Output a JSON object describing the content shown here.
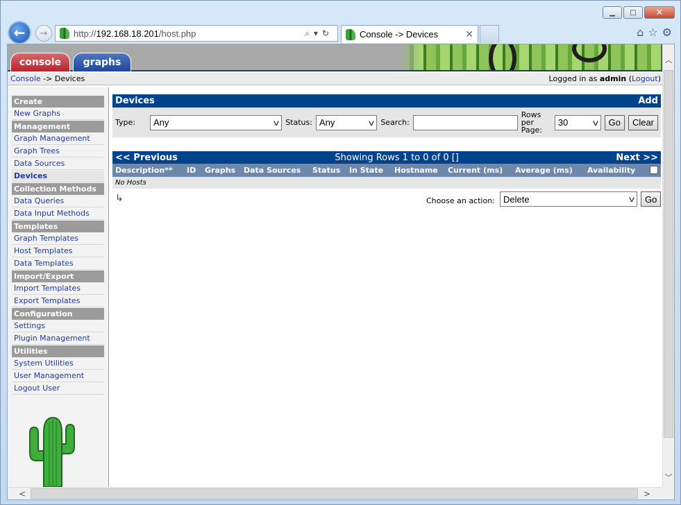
{
  "browser": {
    "url_prefix": "http://",
    "url_host": "192.168.18.201",
    "url_path": "/host.php",
    "tab_title": "Console -> Devices",
    "window_buttons": {
      "minimize": "▁",
      "maximize": "□",
      "close": "✕"
    },
    "icons": {
      "back": "←",
      "forward": "→",
      "search": "⌕",
      "dropdown": "▾",
      "refresh": "↻",
      "tab_close": "✕",
      "home": "⌂",
      "favorites": "☆",
      "settings": "⚙"
    }
  },
  "cacti": {
    "tabs": {
      "console": "console",
      "graphs": "graphs"
    },
    "breadcrumb": {
      "root": "Console",
      "sep": " -> ",
      "current": "Devices"
    },
    "login": {
      "prefix": "Logged in as ",
      "user": "admin",
      "open": " (",
      "logout": "Logout",
      "close": ")"
    },
    "menu": [
      {
        "type": "head",
        "label": "Create"
      },
      {
        "type": "item",
        "label": "New Graphs"
      },
      {
        "type": "head",
        "label": "Management"
      },
      {
        "type": "item",
        "label": "Graph Management"
      },
      {
        "type": "item",
        "label": "Graph Trees"
      },
      {
        "type": "item",
        "label": "Data Sources"
      },
      {
        "type": "item",
        "label": "Devices",
        "active": true
      },
      {
        "type": "head",
        "label": "Collection Methods"
      },
      {
        "type": "item",
        "label": "Data Queries"
      },
      {
        "type": "item",
        "label": "Data Input Methods"
      },
      {
        "type": "head",
        "label": "Templates"
      },
      {
        "type": "item",
        "label": "Graph Templates"
      },
      {
        "type": "item",
        "label": "Host Templates"
      },
      {
        "type": "item",
        "label": "Data Templates"
      },
      {
        "type": "head",
        "label": "Import/Export"
      },
      {
        "type": "item",
        "label": "Import Templates"
      },
      {
        "type": "item",
        "label": "Export Templates"
      },
      {
        "type": "head",
        "label": "Configuration"
      },
      {
        "type": "item",
        "label": "Settings"
      },
      {
        "type": "item",
        "label": "Plugin Management"
      },
      {
        "type": "head",
        "label": "Utilities"
      },
      {
        "type": "item",
        "label": "System Utilities"
      },
      {
        "type": "item",
        "label": "User Management"
      },
      {
        "type": "item",
        "label": "Logout User"
      }
    ],
    "devices": {
      "title": "Devices",
      "add": "Add",
      "filter": {
        "type_label": "Type:",
        "type_value": "Any",
        "status_label": "Status:",
        "status_value": "Any",
        "search_label": "Search:",
        "search_value": "",
        "rows_label": "Rows per Page:",
        "rows_value": "30",
        "go": "Go",
        "clear": "Clear"
      },
      "nav": {
        "prev": "<< Previous",
        "info": "Showing Rows 1 to 0 of 0 []",
        "next": "Next >>"
      },
      "columns": [
        "Description**",
        "ID",
        "Graphs",
        "Data Sources",
        "Status",
        "In State",
        "Hostname",
        "Current (ms)",
        "Average (ms)",
        "Availability"
      ],
      "empty": "No Hosts",
      "action": {
        "label": "Choose an action:",
        "value": "Delete",
        "go": "Go",
        "arrow": "↳"
      }
    }
  },
  "colors": {
    "header_blue": "#00438c",
    "column_blue": "#6d88ad",
    "menu_head": "#9b9b9b",
    "link": "#1a3aa8"
  }
}
